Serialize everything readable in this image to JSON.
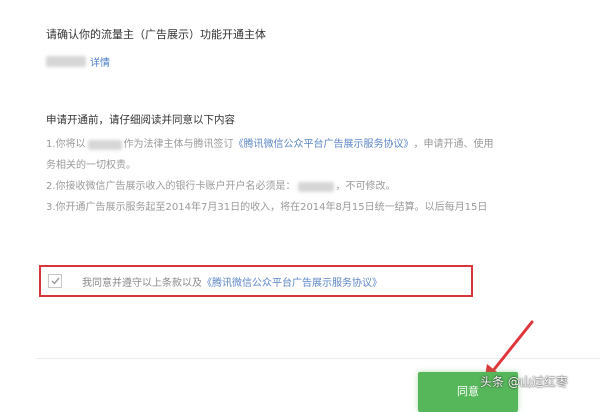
{
  "confirm": {
    "title": "请确认你的流量主（广告展示）功能开通主体",
    "detail_link": "详情"
  },
  "notice": {
    "title": "申请开通前，请仔细阅读并同意以下内容"
  },
  "terms": {
    "line1_a": "1.你将以",
    "line1_b": "作为法律主体与腾讯签订",
    "line1_link": "《腾讯微信公众平台广告展示服务协议》",
    "line1_c": "，申请开通、使用",
    "line1_cont": "务相关的一切权责。",
    "line2_a": "2.你接收微信广告展示收入的银行卡账户开户名必须是：",
    "line2_b": "，不可修改。",
    "line3": "3.你开通广告展示服务起至2014年7月31日的收入，将在2014年8月15日统一结算。以后每月15日"
  },
  "consent": {
    "text": "我同意并遵守以上条款以及",
    "link": "《腾讯微信公众平台广告展示服务协议》",
    "checked": true
  },
  "actions": {
    "agree_label": "同意"
  },
  "watermark": {
    "text": "头条 @山过红枣"
  },
  "colors": {
    "link": "#4a7cc5",
    "highlight_border": "#d9363b",
    "primary_button": "#56b75a",
    "annotation_arrow": "#e0353a"
  }
}
